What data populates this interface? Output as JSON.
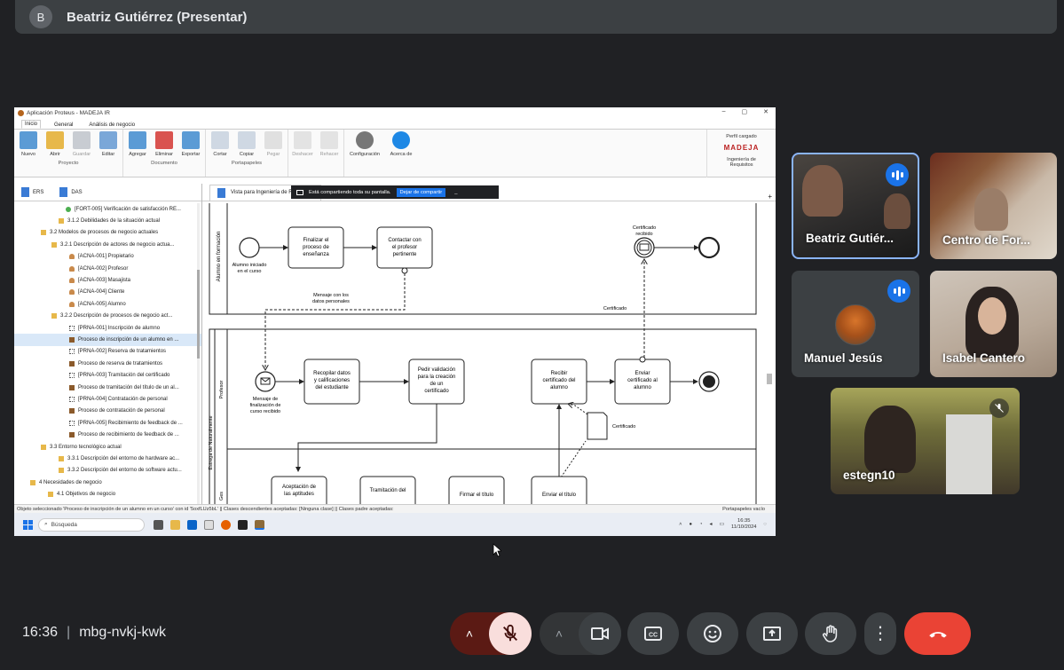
{
  "meeting": {
    "presenter_avatar": "B",
    "presenter_title": "Beatriz Gutiérrez (Presentar)",
    "time": "16:36",
    "code": "mbg-nvkj-kwk"
  },
  "app": {
    "window_title": "Aplicación Proteus - MADEJA IR",
    "ribbon_tabs": [
      "Inicio",
      "General",
      "Análisis de negocio"
    ],
    "groups": [
      {
        "label": "Proyecto",
        "buttons": [
          "Nuevo",
          "Abrir",
          "Guardar",
          "Editar"
        ]
      },
      {
        "label": "Documento",
        "buttons": [
          "Agregar",
          "Eliminar",
          "Exportar"
        ]
      },
      {
        "label": "Portapapeles",
        "buttons": [
          "Cortar",
          "Copiar",
          "Pegar"
        ]
      },
      {
        "label": "",
        "buttons": [
          "Deshacer",
          "Rehacer"
        ]
      },
      {
        "label": "",
        "buttons": [
          "Configuración",
          "Acerca de"
        ]
      }
    ],
    "profile_status": "Perfil cargado",
    "profile_logo": "MADEJA",
    "profile_name": "Ingeniería de Requisitos",
    "share_notice": "Está compartiendo toda su pantalla.",
    "share_stop": "Dejar de compartir",
    "share_hide": "_",
    "left_tabs": [
      "ERS",
      "DAS"
    ],
    "tree": [
      {
        "text": "[FORT-005] Verificación de satisfacción RE...",
        "indent": 54,
        "icon": "green"
      },
      {
        "text": "3.1.2 Debilidades de la situación actual",
        "indent": 46,
        "icon": "folder"
      },
      {
        "text": "3.2 Modelos de procesos de negocio actuales",
        "indent": 26,
        "icon": "folder"
      },
      {
        "text": "3.2.1 Descripción de actores de negocio actua...",
        "indent": 38,
        "icon": "folder"
      },
      {
        "text": "[ACNA-001] Propietario",
        "indent": 58,
        "icon": "user"
      },
      {
        "text": "[ACNA-002] Profesor",
        "indent": 58,
        "icon": "user"
      },
      {
        "text": "[ACNA-003] Masajista",
        "indent": 58,
        "icon": "user"
      },
      {
        "text": "[ACNA-004] Cliente",
        "indent": 58,
        "icon": "user"
      },
      {
        "text": "[ACNA-005] Alumno",
        "indent": 58,
        "icon": "user"
      },
      {
        "text": "3.2.2 Descripción de procesos de negocio act...",
        "indent": 38,
        "icon": "folder"
      },
      {
        "text": "[PRNA-001] Inscripción de alumno",
        "indent": 58,
        "icon": "grid"
      },
      {
        "text": "Proceso de inscripción de un alumno en ...",
        "indent": 58,
        "icon": "proc",
        "selected": true
      },
      {
        "text": "[PRNA-002] Reserva de tratamientos",
        "indent": 58,
        "icon": "grid"
      },
      {
        "text": "Proceso de reserva de tratamientos",
        "indent": 58,
        "icon": "proc"
      },
      {
        "text": "[PRNA-003] Tramitación del certificado",
        "indent": 58,
        "icon": "grid"
      },
      {
        "text": "Proceso de tramitación del título de un al...",
        "indent": 58,
        "icon": "proc"
      },
      {
        "text": "[PRNA-004] Contratación de personal",
        "indent": 58,
        "icon": "grid"
      },
      {
        "text": "Proceso de contratación de personal",
        "indent": 58,
        "icon": "proc"
      },
      {
        "text": "[PRNA-005] Recibimiento de feedback de ...",
        "indent": 58,
        "icon": "grid"
      },
      {
        "text": "Proceso de recibimiento de feedback de ...",
        "indent": 58,
        "icon": "proc"
      },
      {
        "text": "3.3 Entorno tecnológico actual",
        "indent": 26,
        "icon": "folder"
      },
      {
        "text": "3.3.1 Descripción del entorno de hardware ac...",
        "indent": 46,
        "icon": "folder"
      },
      {
        "text": "3.3.2 Descripción del entorno de software actu...",
        "indent": 46,
        "icon": "folder"
      },
      {
        "text": "4 Necesidades de negocio",
        "indent": 14,
        "icon": "folder"
      },
      {
        "text": "4.1 Objetivos de negocio",
        "indent": 34,
        "icon": "folder"
      }
    ],
    "view_tab": "Vista para Ingeniería de Requisitos",
    "diagram": {
      "lane1": "Alumno en formación",
      "lane2": "Profesor",
      "pool2": "Estrega de Naturalmente",
      "lane3": "Ges",
      "start1_label": [
        "Alumno iniciado",
        "en el curso"
      ],
      "task_finalizar": [
        "Finalizar el",
        "proceso de",
        "enseñanza"
      ],
      "task_contactar": [
        "Contactar con",
        "el profesor",
        "pertinente"
      ],
      "cert_recibido": [
        "Certificado",
        "recibido"
      ],
      "msg_datos": [
        "Mensaje con los",
        "datos personales"
      ],
      "certificado_flow": "Certificado",
      "msg_start2": [
        "Mensaje de",
        "finalización de",
        "curso recibido"
      ],
      "task_recopilar": [
        "Recopilar datos",
        "y calificaciones",
        "del estudiante"
      ],
      "task_pedir": [
        "Pedir validación",
        "para la creación",
        "de un",
        "certificado"
      ],
      "task_recibir": [
        "Recibir",
        "certificado del",
        "alumno"
      ],
      "task_enviar": [
        "Enviar",
        "certificado al",
        "alumno"
      ],
      "doc_cert": "Certificado",
      "task_aceptacion": [
        "Aceptación de",
        "las aptitudes"
      ],
      "task_tramitacion": [
        "Tramitación del"
      ],
      "task_firmar": [
        "Firmar el título"
      ],
      "task_enviar_titulo": [
        "Enviar el título"
      ]
    },
    "status_text": "Objeto seleccionado 'Proceso de inscripción de un alumno en un curso' con id '5oxfLUz5bL' || Clases descendientes aceptadas: [Ninguna clase] || Clases padre aceptadas:",
    "status_right": "Portapapeles vacío",
    "taskbar_search": "Búsqueda",
    "taskbar_time": "16:35",
    "taskbar_date": "11/10/2024"
  },
  "participants": [
    {
      "name": "Beatriz Gutiér...",
      "speaking": true
    },
    {
      "name": "Centro de For...",
      "speaking": false
    },
    {
      "name": "Manuel Jesús",
      "speaking": true
    },
    {
      "name": "Isabel Cantero",
      "speaking": false
    },
    {
      "name": "estegn10",
      "muted": true
    }
  ],
  "icons": {
    "mic": "mic-off-icon",
    "cam": "videocam-icon",
    "cc": "captions-icon",
    "emoji": "emoji-icon",
    "present": "present-screen-icon",
    "hand": "raise-hand-icon",
    "more": "more-vert-icon",
    "hangup": "call-end-icon"
  },
  "colors": {
    "hangup": "#ea4335",
    "mic_bg": "#f9dedc",
    "speaking": "#1a73e8",
    "pin_border": "#8ab4f8"
  }
}
